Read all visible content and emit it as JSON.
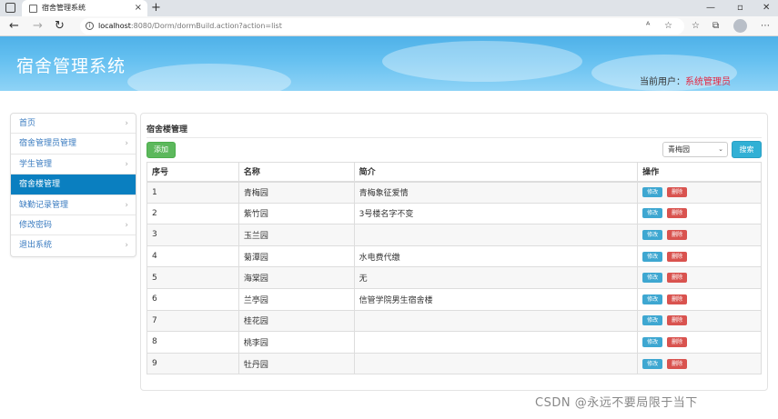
{
  "browser": {
    "tab_title": "宿舍管理系统",
    "tab_close": "×",
    "new_tab": "+",
    "url_host": "localhost",
    "url_path": ":8080/Dorm/dormBuild.action?action=list",
    "back": "←",
    "forward": "→",
    "reload": "↻",
    "minimize": "—",
    "maximize": "▫",
    "close": "✕"
  },
  "header": {
    "title": "宿舍管理系统",
    "current_user_label": "当前用户：",
    "current_user": "系统管理员"
  },
  "sidebar": {
    "items": [
      {
        "label": "首页",
        "active": false
      },
      {
        "label": "宿舍管理员管理",
        "active": false
      },
      {
        "label": "学生管理",
        "active": false
      },
      {
        "label": "宿舍楼管理",
        "active": true
      },
      {
        "label": "缺勤记录管理",
        "active": false
      },
      {
        "label": "修改密码",
        "active": false
      },
      {
        "label": "退出系统",
        "active": false
      }
    ]
  },
  "main": {
    "title": "宿舍楼管理",
    "add_label": "添加",
    "filter_value": "青梅园",
    "search_label": "搜索",
    "columns": [
      "序号",
      "名称",
      "简介",
      "操作"
    ],
    "edit_label": "修改",
    "delete_label": "删除",
    "rows": [
      {
        "id": "1",
        "name": "青梅园",
        "desc": "青梅象征爱情"
      },
      {
        "id": "2",
        "name": "紫竹园",
        "desc": "3号楼名字不变"
      },
      {
        "id": "3",
        "name": "玉兰园",
        "desc": ""
      },
      {
        "id": "4",
        "name": "菊潭园",
        "desc": "水电费代缴"
      },
      {
        "id": "5",
        "name": "海棠园",
        "desc": "无"
      },
      {
        "id": "6",
        "name": "兰亭园",
        "desc": "信管学院男生宿舍楼"
      },
      {
        "id": "7",
        "name": "桂花园",
        "desc": ""
      },
      {
        "id": "8",
        "name": "桃李园",
        "desc": ""
      },
      {
        "id": "9",
        "name": "牡丹园",
        "desc": ""
      }
    ]
  },
  "watermark": "CSDN @永远不要局限于当下",
  "colors": {
    "header_blue": "#4fb1e8",
    "active_nav": "#0a7fc0",
    "user_red": "#e4233e",
    "add_green": "#5cb85c",
    "search_cyan": "#31b0d5",
    "delete_red": "#d9534f"
  }
}
